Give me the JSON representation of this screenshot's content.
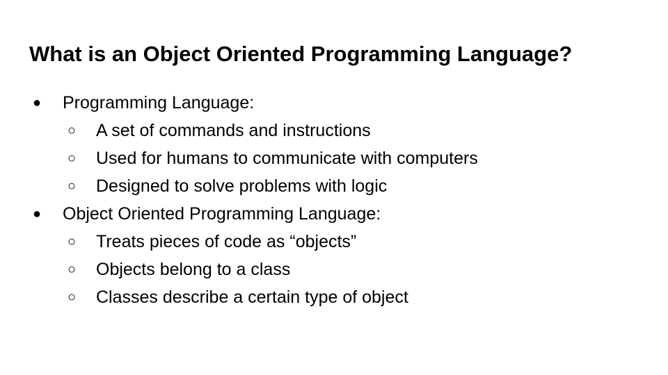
{
  "slide": {
    "title": "What is an Object Oriented Programming Language?",
    "bullet_marker": "●",
    "sub_bullet_marker": "○",
    "sections": [
      {
        "heading": "Programming Language:",
        "items": [
          "A set of commands and instructions",
          "Used for humans to communicate with computers",
          "Designed to solve problems with logic"
        ]
      },
      {
        "heading": "Object Oriented Programming Language:",
        "items": [
          "Treats pieces of code as “objects”",
          "Objects belong to a class",
          "Classes describe a certain type of object"
        ]
      }
    ]
  }
}
